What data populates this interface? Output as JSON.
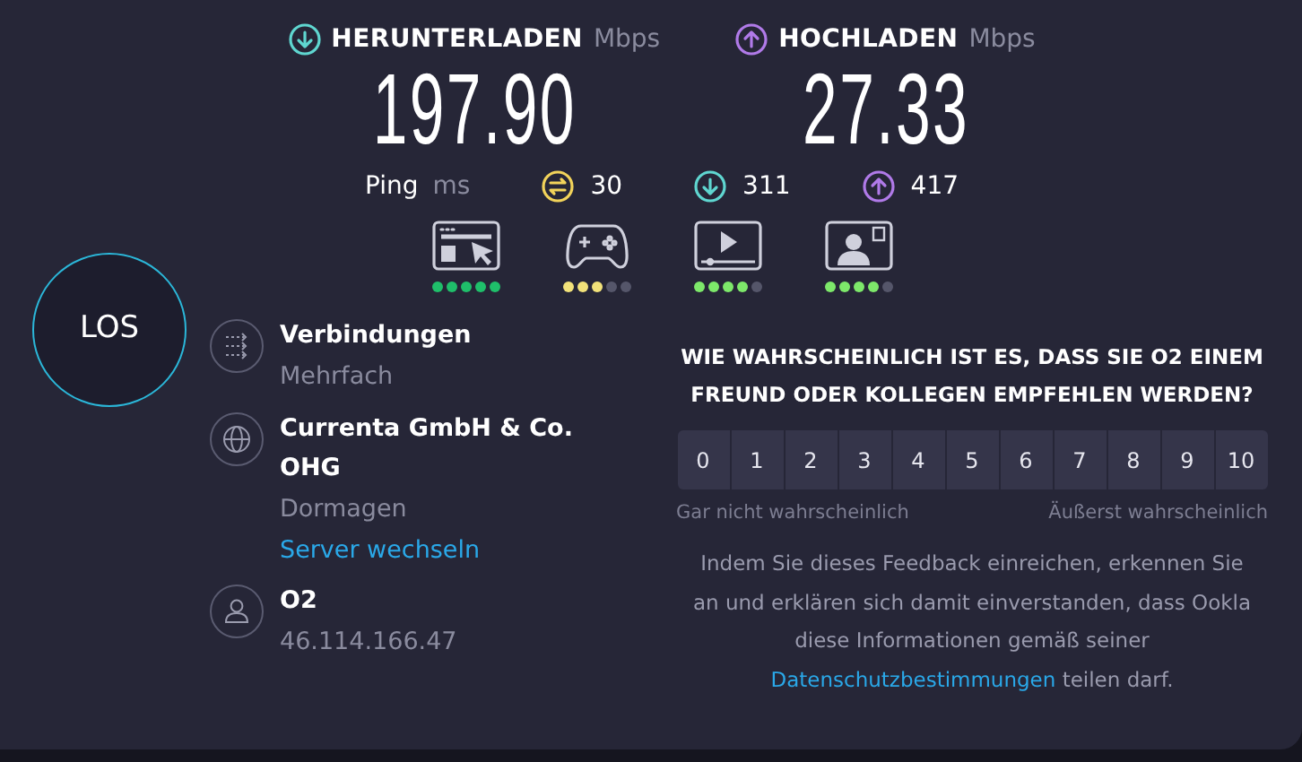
{
  "download": {
    "label": "HERUNTERLADEN",
    "unit": "Mbps",
    "value": "197.90"
  },
  "upload": {
    "label": "HOCHLADEN",
    "unit": "Mbps",
    "value": "27.33"
  },
  "ping": {
    "label": "Ping",
    "unit": "ms",
    "items": [
      {
        "kind": "idle",
        "value": "30"
      },
      {
        "kind": "down",
        "value": "311"
      },
      {
        "kind": "up",
        "value": "417"
      }
    ]
  },
  "quality": [
    {
      "kind": "browsing",
      "stars": 5,
      "color": "#1fbf6a"
    },
    {
      "kind": "gaming",
      "stars": 3,
      "color": "#f2e27a"
    },
    {
      "kind": "video",
      "stars": 4,
      "color": "#7de86a"
    },
    {
      "kind": "call",
      "stars": 4,
      "color": "#7de86a"
    }
  ],
  "go_button": "LOS",
  "info": [
    {
      "kind": "connections",
      "title": "Verbindungen",
      "lines": [
        {
          "text": "Mehrfach",
          "kind": "muted"
        }
      ]
    },
    {
      "kind": "server",
      "title": "Currenta GmbH & Co. OHG",
      "lines": [
        {
          "text": "Dormagen",
          "kind": "muted"
        },
        {
          "text": "Server wechseln",
          "kind": "link"
        }
      ]
    },
    {
      "kind": "provider",
      "title": "O2",
      "lines": [
        {
          "text": "46.114.166.47",
          "kind": "muted"
        }
      ]
    }
  ],
  "survey": {
    "question": "WIE WAHRSCHEINLICH IST ES, DASS SIE O2 EINEM FREUND ODER KOLLEGEN EMPFEHLEN WERDEN?",
    "scale": [
      "0",
      "1",
      "2",
      "3",
      "4",
      "5",
      "6",
      "7",
      "8",
      "9",
      "10"
    ],
    "low_label": "Gar nicht wahrscheinlich",
    "high_label": "Äußerst wahrscheinlich",
    "disclaimer": "Indem Sie dieses Feedback einreichen, erkennen Sie an und erklären sich damit einverstanden, dass Ookla diese Informationen gemäß seiner",
    "link": "Datenschutzbestimmungen",
    "disclaimer_end": "teilen darf."
  }
}
